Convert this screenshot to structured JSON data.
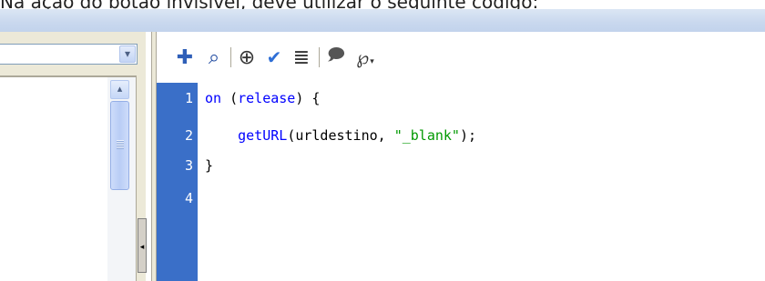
{
  "caption": "Na ação do botão invisível, deve utilizar o seguinte código:",
  "left_panel": {
    "combo_arrow": "▾",
    "scroll_up_arrow": "▴",
    "splitter_arrow": "◂"
  },
  "toolbar": {
    "buttons": [
      {
        "name": "add-statement",
        "glyph": "✚",
        "color": "#2f5fb8"
      },
      {
        "name": "find",
        "glyph": "⌕",
        "color": "#1f4aa0"
      },
      {
        "name": "insert-target-path",
        "glyph": "⊕",
        "color": "#333333"
      },
      {
        "name": "check-syntax",
        "glyph": "✔",
        "color": "#2f6fd6"
      },
      {
        "name": "auto-format",
        "glyph": "≣",
        "color": "#333333"
      },
      {
        "name": "show-code-hint",
        "glyph": "🗩",
        "color": "#555555"
      },
      {
        "name": "debug-options",
        "glyph": "℘",
        "color": "#333333"
      }
    ]
  },
  "editor": {
    "line_numbers": [
      "1",
      "2",
      "3",
      "4"
    ],
    "lines": [
      {
        "kw": "on",
        "rest": " (",
        "kw2": "release",
        "tail": ") {"
      },
      {
        "indent": "    ",
        "fn": "getURL",
        "rest": "(urldestino, ",
        "str": "\"_blank\"",
        "tail": ");"
      },
      {
        "tail": "}"
      }
    ]
  }
}
